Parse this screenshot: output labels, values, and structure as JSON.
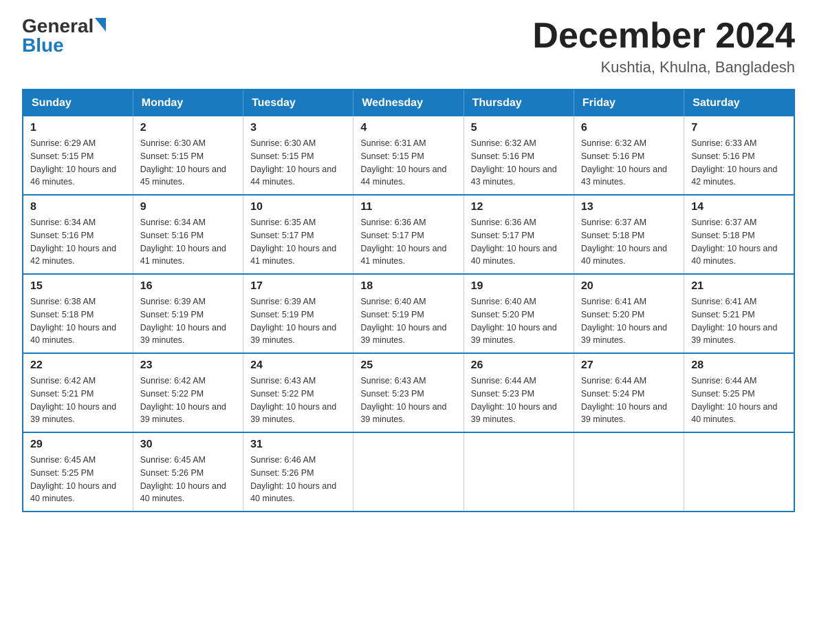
{
  "header": {
    "logo": {
      "general": "General",
      "blue": "Blue"
    },
    "title": "December 2024",
    "location": "Kushtia, Khulna, Bangladesh"
  },
  "calendar": {
    "days_of_week": [
      "Sunday",
      "Monday",
      "Tuesday",
      "Wednesday",
      "Thursday",
      "Friday",
      "Saturday"
    ],
    "weeks": [
      [
        {
          "day": "1",
          "sunrise": "6:29 AM",
          "sunset": "5:15 PM",
          "daylight": "10 hours and 46 minutes."
        },
        {
          "day": "2",
          "sunrise": "6:30 AM",
          "sunset": "5:15 PM",
          "daylight": "10 hours and 45 minutes."
        },
        {
          "day": "3",
          "sunrise": "6:30 AM",
          "sunset": "5:15 PM",
          "daylight": "10 hours and 44 minutes."
        },
        {
          "day": "4",
          "sunrise": "6:31 AM",
          "sunset": "5:15 PM",
          "daylight": "10 hours and 44 minutes."
        },
        {
          "day": "5",
          "sunrise": "6:32 AM",
          "sunset": "5:16 PM",
          "daylight": "10 hours and 43 minutes."
        },
        {
          "day": "6",
          "sunrise": "6:32 AM",
          "sunset": "5:16 PM",
          "daylight": "10 hours and 43 minutes."
        },
        {
          "day": "7",
          "sunrise": "6:33 AM",
          "sunset": "5:16 PM",
          "daylight": "10 hours and 42 minutes."
        }
      ],
      [
        {
          "day": "8",
          "sunrise": "6:34 AM",
          "sunset": "5:16 PM",
          "daylight": "10 hours and 42 minutes."
        },
        {
          "day": "9",
          "sunrise": "6:34 AM",
          "sunset": "5:16 PM",
          "daylight": "10 hours and 41 minutes."
        },
        {
          "day": "10",
          "sunrise": "6:35 AM",
          "sunset": "5:17 PM",
          "daylight": "10 hours and 41 minutes."
        },
        {
          "day": "11",
          "sunrise": "6:36 AM",
          "sunset": "5:17 PM",
          "daylight": "10 hours and 41 minutes."
        },
        {
          "day": "12",
          "sunrise": "6:36 AM",
          "sunset": "5:17 PM",
          "daylight": "10 hours and 40 minutes."
        },
        {
          "day": "13",
          "sunrise": "6:37 AM",
          "sunset": "5:18 PM",
          "daylight": "10 hours and 40 minutes."
        },
        {
          "day": "14",
          "sunrise": "6:37 AM",
          "sunset": "5:18 PM",
          "daylight": "10 hours and 40 minutes."
        }
      ],
      [
        {
          "day": "15",
          "sunrise": "6:38 AM",
          "sunset": "5:18 PM",
          "daylight": "10 hours and 40 minutes."
        },
        {
          "day": "16",
          "sunrise": "6:39 AM",
          "sunset": "5:19 PM",
          "daylight": "10 hours and 39 minutes."
        },
        {
          "day": "17",
          "sunrise": "6:39 AM",
          "sunset": "5:19 PM",
          "daylight": "10 hours and 39 minutes."
        },
        {
          "day": "18",
          "sunrise": "6:40 AM",
          "sunset": "5:19 PM",
          "daylight": "10 hours and 39 minutes."
        },
        {
          "day": "19",
          "sunrise": "6:40 AM",
          "sunset": "5:20 PM",
          "daylight": "10 hours and 39 minutes."
        },
        {
          "day": "20",
          "sunrise": "6:41 AM",
          "sunset": "5:20 PM",
          "daylight": "10 hours and 39 minutes."
        },
        {
          "day": "21",
          "sunrise": "6:41 AM",
          "sunset": "5:21 PM",
          "daylight": "10 hours and 39 minutes."
        }
      ],
      [
        {
          "day": "22",
          "sunrise": "6:42 AM",
          "sunset": "5:21 PM",
          "daylight": "10 hours and 39 minutes."
        },
        {
          "day": "23",
          "sunrise": "6:42 AM",
          "sunset": "5:22 PM",
          "daylight": "10 hours and 39 minutes."
        },
        {
          "day": "24",
          "sunrise": "6:43 AM",
          "sunset": "5:22 PM",
          "daylight": "10 hours and 39 minutes."
        },
        {
          "day": "25",
          "sunrise": "6:43 AM",
          "sunset": "5:23 PM",
          "daylight": "10 hours and 39 minutes."
        },
        {
          "day": "26",
          "sunrise": "6:44 AM",
          "sunset": "5:23 PM",
          "daylight": "10 hours and 39 minutes."
        },
        {
          "day": "27",
          "sunrise": "6:44 AM",
          "sunset": "5:24 PM",
          "daylight": "10 hours and 39 minutes."
        },
        {
          "day": "28",
          "sunrise": "6:44 AM",
          "sunset": "5:25 PM",
          "daylight": "10 hours and 40 minutes."
        }
      ],
      [
        {
          "day": "29",
          "sunrise": "6:45 AM",
          "sunset": "5:25 PM",
          "daylight": "10 hours and 40 minutes."
        },
        {
          "day": "30",
          "sunrise": "6:45 AM",
          "sunset": "5:26 PM",
          "daylight": "10 hours and 40 minutes."
        },
        {
          "day": "31",
          "sunrise": "6:46 AM",
          "sunset": "5:26 PM",
          "daylight": "10 hours and 40 minutes."
        },
        null,
        null,
        null,
        null
      ]
    ]
  }
}
